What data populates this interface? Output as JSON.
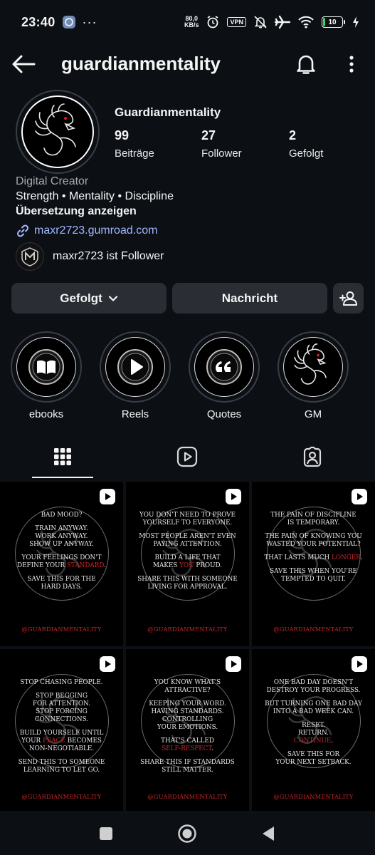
{
  "status_bar": {
    "time": "23:40",
    "dots": "···",
    "speed_value": "80,0",
    "speed_unit": "KB/s",
    "vpn": "VPN",
    "battery": "10",
    "icons": [
      "alarm-icon",
      "mute-icon",
      "airplane-icon",
      "wifi-icon",
      "charging-icon"
    ]
  },
  "header": {
    "title": "guardianmentality",
    "icons": [
      "back-arrow-icon",
      "bell-icon",
      "more-vertical-icon"
    ]
  },
  "profile": {
    "name": "Guardianmentality",
    "stats": [
      {
        "value": "99",
        "label": "Beiträge"
      },
      {
        "value": "27",
        "label": "Follower"
      },
      {
        "value": "2",
        "label": "Gefolgt"
      }
    ],
    "category": "Digital Creator",
    "bio": "Strength • Mentality • Discipline",
    "translate": "Übersetzung anzeigen",
    "link": "maxr2723.gumroad.com",
    "follower_note": "maxr2723 ist Follower"
  },
  "actions": {
    "following": "Gefolgt",
    "message": "Nachricht"
  },
  "highlights": [
    {
      "label": "ebooks",
      "icon": "book-icon"
    },
    {
      "label": "Reels",
      "icon": "play-icon"
    },
    {
      "label": "Quotes",
      "icon": "quote-icon"
    },
    {
      "label": "GM",
      "icon": "dragon-icon"
    }
  ],
  "tabs": [
    {
      "icon": "grid-icon",
      "active": true
    },
    {
      "icon": "reels-icon",
      "active": false
    },
    {
      "icon": "tagged-icon",
      "active": false
    }
  ],
  "posts": [
    {
      "lines": [
        [
          "BAD MOOD?"
        ],
        [
          "TRAIN ANYWAY.",
          "WORK ANYWAY.",
          "SHOW UP ANYWAY."
        ],
        [
          "YOUR FEELINGS DON'T",
          "DEFINE YOUR |STANDARD|."
        ],
        [
          "SAVE THIS FOR THE",
          "HARD DAYS."
        ]
      ],
      "handle": "@GUARDIANMENTALITY"
    },
    {
      "lines": [
        [
          "YOU DON'T NEED TO PROVE",
          "YOURSELF TO EVERYONE."
        ],
        [
          "MOST PEOPLE AREN'T EVEN",
          "PAYING ATTENTION."
        ],
        [
          "BUILD A LIFE THAT",
          "MAKES |YOU| PROUD."
        ],
        [
          "SHARE THIS WITH SOMEONE",
          "LIVING FOR APPROVAL."
        ]
      ],
      "handle": "@GUARDIANMENTALITY"
    },
    {
      "lines": [
        [
          "THE PAIN OF DISCIPLINE",
          "IS TEMPORARY."
        ],
        [
          "THE PAIN OF KNOWING YOU",
          "WASTED YOUR POTENTIAL?"
        ],
        [
          "THAT LASTS MUCH |LONGER|."
        ],
        [
          "SAVE THIS WHEN YOU'RE",
          "TEMPTED TO QUIT."
        ]
      ],
      "handle": "@GUARDIANMENTALITY"
    },
    {
      "lines": [
        [
          "STOP CHASING PEOPLE."
        ],
        [
          "STOP BEGGING",
          "FOR ATTENTION.",
          "STOP FORCING",
          "CONNECTIONS."
        ],
        [
          "BUILD YOURSELF UNTIL",
          "YOUR |PEACE| BECOMES",
          "NON-NEGOTIABLE."
        ],
        [
          "SEND THIS TO SOMEONE",
          "LEARNING TO LET GO."
        ]
      ],
      "handle": "@GUARDIANMENTALITY"
    },
    {
      "lines": [
        [
          "YOU KNOW WHAT'S",
          "ATTRACTIVE?"
        ],
        [
          "KEEPING YOUR WORD.",
          "HAVING STANDARDS.",
          "CONTROLLING",
          "YOUR EMOTIONS."
        ],
        [
          "THAT'S CALLED",
          "|SELF-RESPECT|."
        ],
        [
          "SHARE THIS IF STANDARDS",
          "STILL MATTER."
        ]
      ],
      "handle": "@GUARDIANMENTALITY"
    },
    {
      "lines": [
        [
          "ONE BAD DAY DOESN'T",
          "DESTROY YOUR PROGRESS."
        ],
        [
          "BUT TURNING ONE BAD DAY",
          "INTO A BAD WEEK CAN."
        ],
        [
          "RESET.",
          "RETURN.",
          "|CONTINUE|."
        ],
        [
          "SAVE THIS FOR",
          "YOUR NEXT SETBACK."
        ]
      ],
      "handle": "@GUARDIANMENTALITY"
    }
  ],
  "colors": {
    "background": "#0c0f14",
    "button": "#2a2d33",
    "link": "#a0b9ff",
    "accent_red": "#c9262a"
  }
}
